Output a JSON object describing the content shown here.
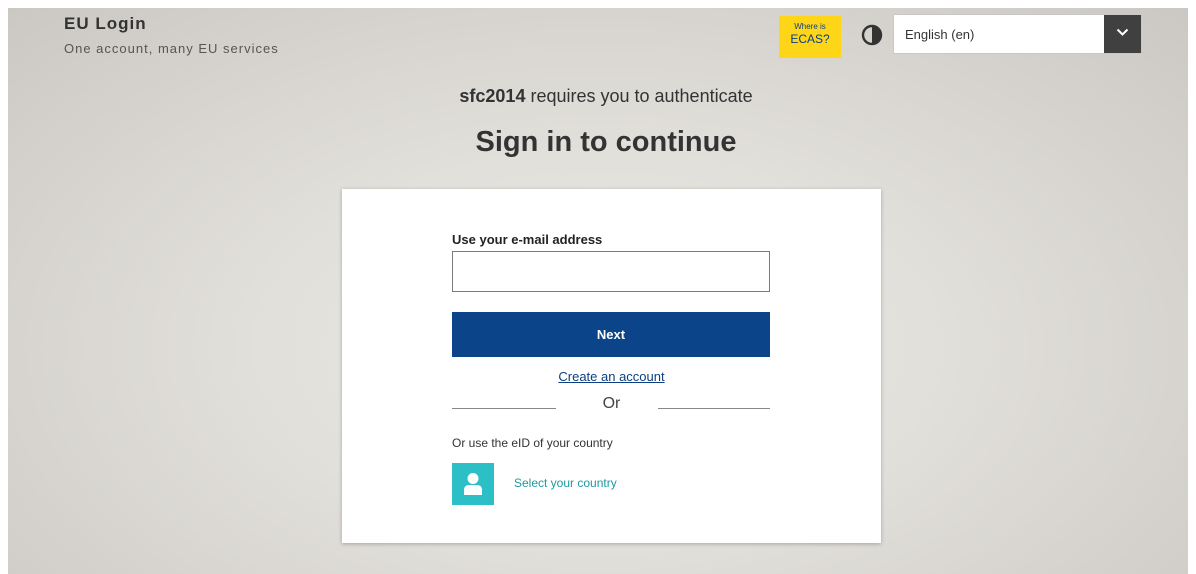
{
  "header": {
    "title": "EU Login",
    "subtitle": "One account, many EU services",
    "ecas": {
      "line1": "Where is",
      "line2": "ECAS?"
    },
    "language": {
      "selected": "English (en)"
    },
    "icons": {
      "contrast": "contrast-icon",
      "dropdown": "chevron-down-icon"
    }
  },
  "auth": {
    "service": "sfc2014",
    "message": " requires you to authenticate",
    "heading": "Sign in to continue"
  },
  "form": {
    "email_label": "Use your e-mail address",
    "email_value": "",
    "next_label": "Next",
    "create_account": "Create an account",
    "or_text": "Or",
    "eid_label": "Or use the eID of your country",
    "country_label": "Select your country",
    "country_icon": "user-icon"
  },
  "colors": {
    "primary_button": "#0b4488",
    "ecas_badge": "#ffd617",
    "eid_icon": "#2cbfc5",
    "link": "#0b3f82"
  }
}
